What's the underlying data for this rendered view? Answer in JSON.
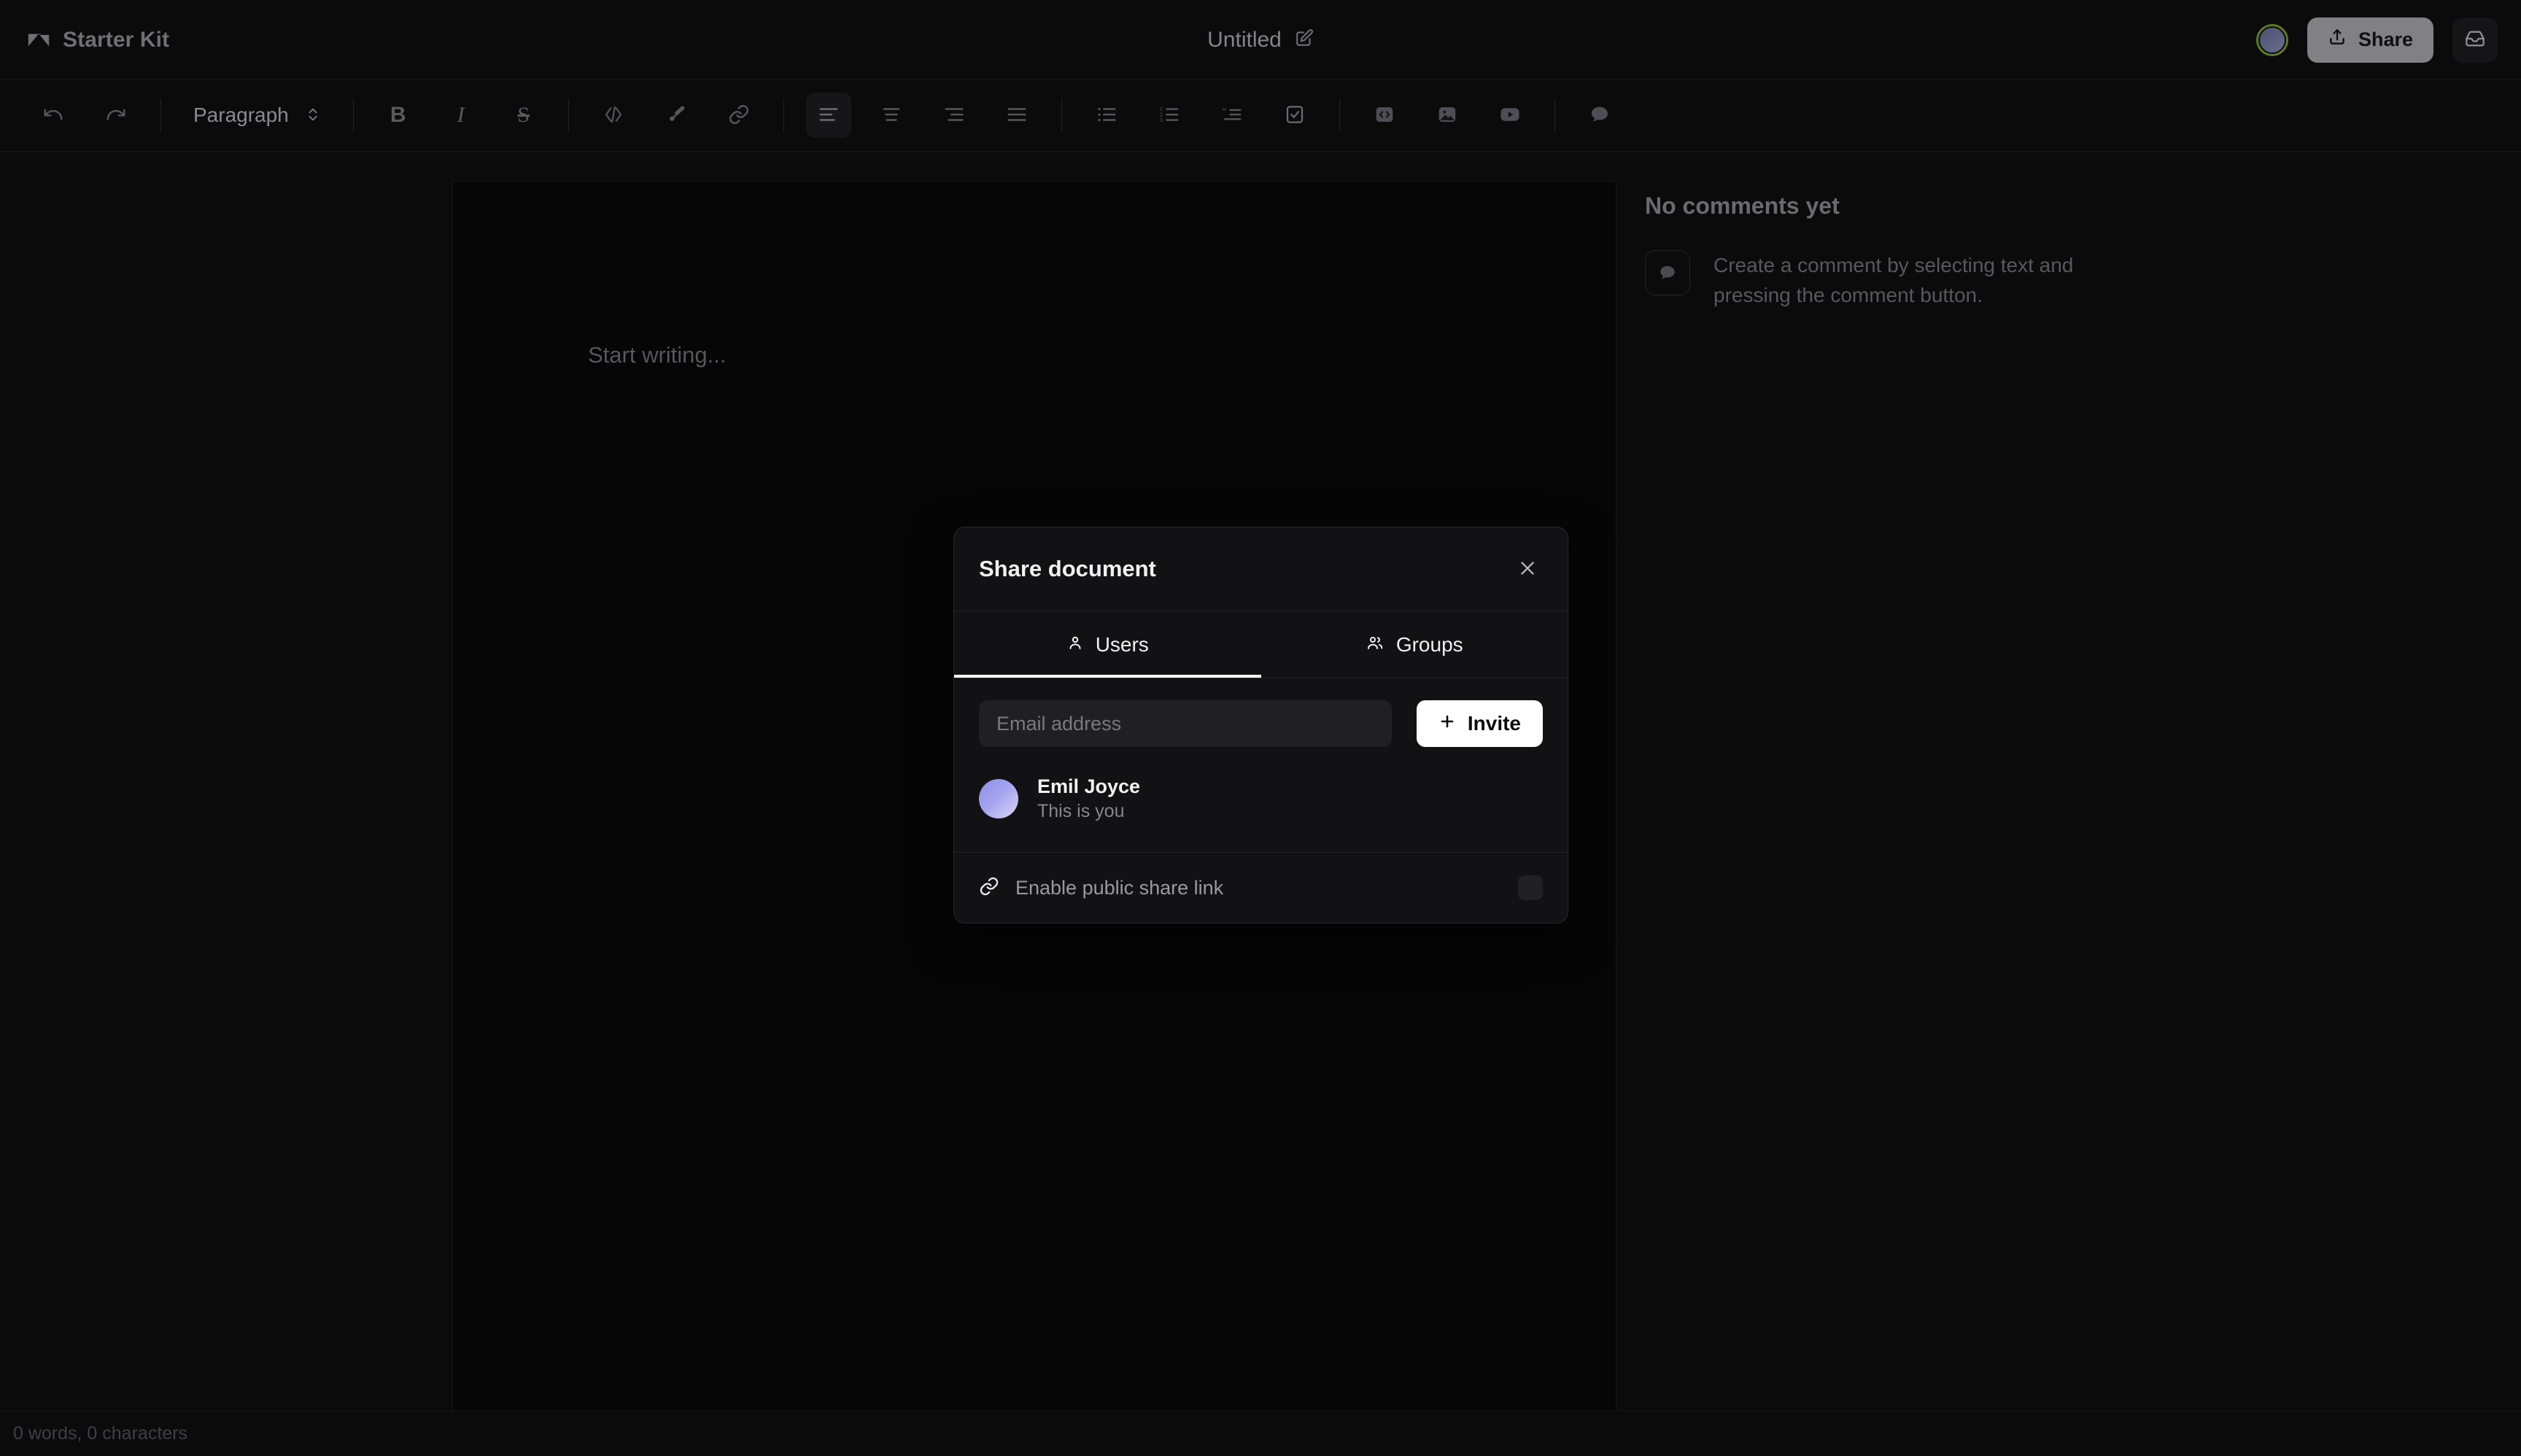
{
  "app": {
    "brand": "Starter Kit",
    "brand_logo_icon": "tiptap-logo-icon"
  },
  "header": {
    "document_title": "Untitled",
    "edit_title_icon": "pencil-square-icon",
    "avatar_icon": "user-avatar",
    "avatar_ring_color": "#5e7a26",
    "share_label": "Share",
    "share_icon": "upload-icon",
    "inbox_icon": "inbox-icon"
  },
  "toolbar": {
    "undo_icon": "undo-icon",
    "redo_icon": "redo-icon",
    "block_type_label": "Paragraph",
    "block_type_icon": "chevron-up-down-icon",
    "bold_label": "B",
    "italic_label": "I",
    "strike_label": "S",
    "code_icon": "code-inline-icon",
    "highlight_icon": "brush-icon",
    "link_icon": "link-icon",
    "align_left_icon": "align-left-icon",
    "align_center_icon": "align-center-icon",
    "align_right_icon": "align-right-icon",
    "align_justify_icon": "align-justify-icon",
    "bullet_list_icon": "bullet-list-icon",
    "ordered_list_icon": "ordered-list-icon",
    "blockquote_icon": "blockquote-icon",
    "task_list_icon": "task-list-icon",
    "code_block_icon": "code-block-icon",
    "image_icon": "image-icon",
    "youtube_icon": "youtube-icon",
    "comment_icon": "comment-icon",
    "active_item": "align-left-icon"
  },
  "editor": {
    "placeholder": "Start writing..."
  },
  "comments_panel": {
    "headline": "No comments yet",
    "empty_icon": "comment-bubble-icon",
    "empty_text": "Create a comment by selecting text and pressing the comment button."
  },
  "statusbar": {
    "counts": "0 words, 0 characters"
  },
  "share_dialog": {
    "title": "Share document",
    "close_icon": "close-icon",
    "tabs": [
      {
        "label": "Users",
        "icon": "user-icon",
        "active": true
      },
      {
        "label": "Groups",
        "icon": "users-group-icon",
        "active": false
      }
    ],
    "email_placeholder": "Email address",
    "email_value": "",
    "invite_label": "Invite",
    "invite_icon": "plus-icon",
    "members": [
      {
        "name": "Emil Joyce",
        "meta": "This is you"
      }
    ],
    "public_link_label": "Enable public share link",
    "public_link_icon": "link-icon",
    "public_link_enabled": false
  }
}
